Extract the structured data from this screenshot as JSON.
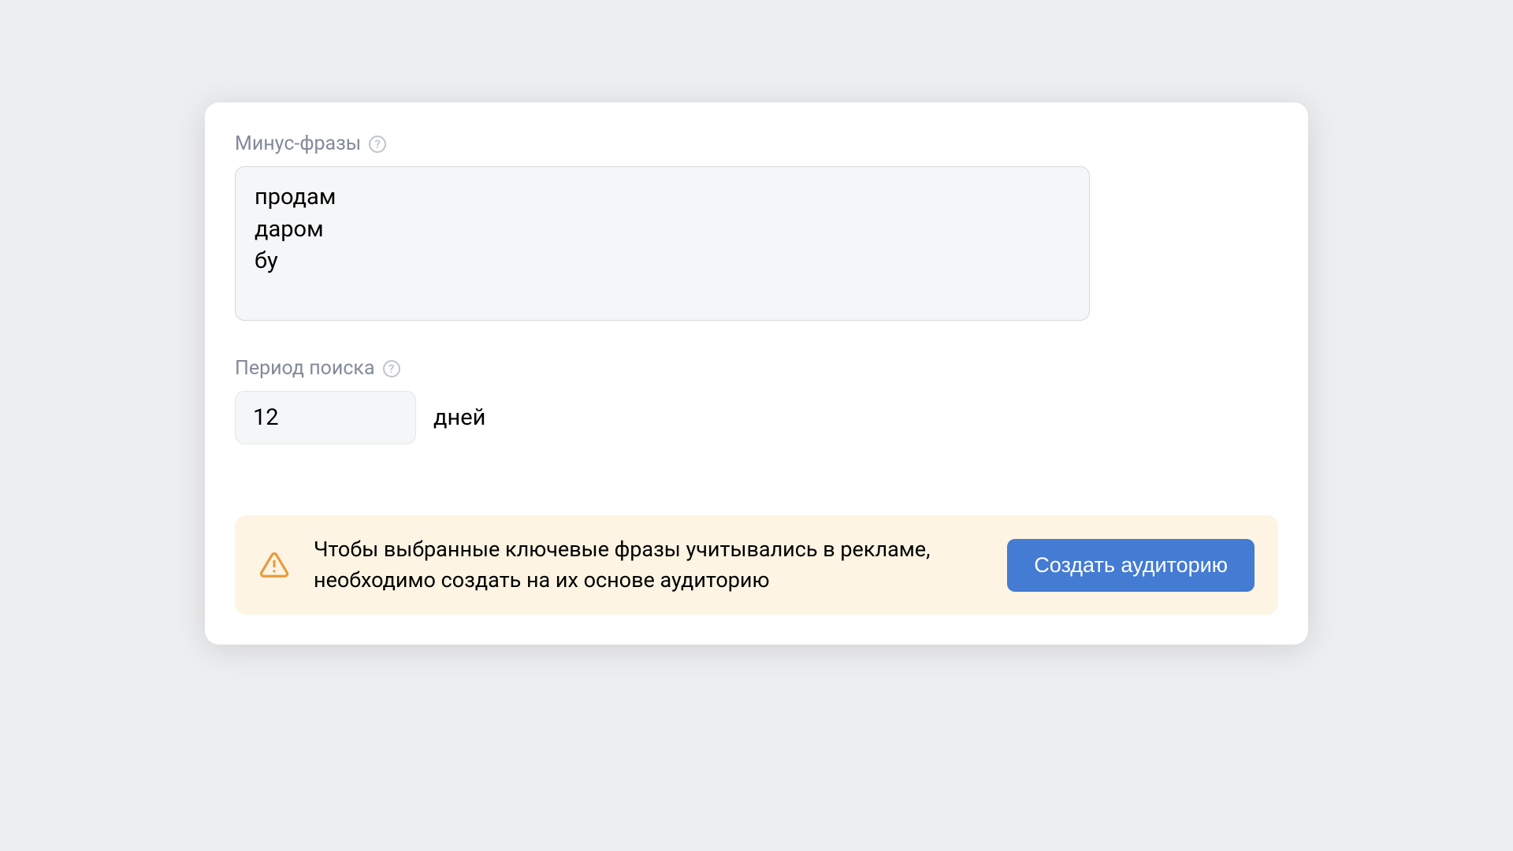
{
  "negativePhrases": {
    "label": "Минус-фразы",
    "value": "продам\nдаром\nбу"
  },
  "searchPeriod": {
    "label": "Период поиска",
    "value": "12",
    "unit": "дней"
  },
  "alert": {
    "message": "Чтобы выбранные ключевые фразы учитывались в рекламе, необходимо создать на их основе аудиторию",
    "buttonLabel": "Создать аудиторию"
  }
}
